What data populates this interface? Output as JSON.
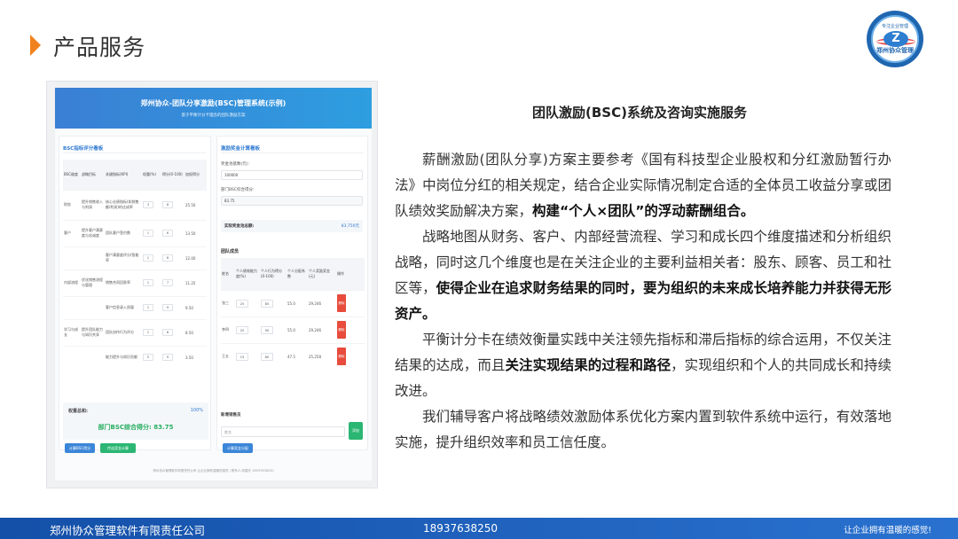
{
  "header": {
    "title": "产品服务"
  },
  "logo": {
    "top_text": "专注企业管理",
    "bottom_text": "郑州协众管理"
  },
  "screenshot": {
    "app_title": "郑州协众-团队分享激励(BSC)管理系统(示例)",
    "app_subtitle": "基于平衡计分卡理念的团队激励方案",
    "left_panel": {
      "title": "BSC指标评分看板",
      "headers": [
        "BSC维度",
        "战略目标",
        "关键指标(KPI)",
        "权重(%)",
        "得分(0-100)",
        "加权得分"
      ],
      "rows": [
        {
          "dim": "财务",
          "goal": "提升销售收入与利润",
          "kpi": "核心业绩指标(如销售额/利润)的达成率",
          "weight": "3",
          "score": "8",
          "weighted": "25.50"
        },
        {
          "dim": "客户",
          "goal": "提升客户满意度与忠诚度",
          "kpi": "团队客户签约数",
          "weight": "1",
          "score": "6",
          "weighted": "13.50"
        },
        {
          "dim": "",
          "goal": "",
          "kpi": "客户满意度评分(智能率",
          "weight": "1",
          "score": "8",
          "weighted": "12.00"
        },
        {
          "dim": "内部流程",
          "goal": "优化销售流程与管理",
          "kpi": "销售合同回款率",
          "weight": "1",
          "score": "7",
          "weighted": "11.25"
        },
        {
          "dim": "",
          "goal": "",
          "kpi": "客户信息录入质量",
          "weight": "1",
          "score": "9",
          "weighted": "9.50"
        },
        {
          "dim": "学习与成长",
          "goal": "提升团队能力与知识共享",
          "kpi": "团队协作行为评分",
          "weight": "1",
          "score": "8",
          "weighted": "8.50"
        },
        {
          "dim": "",
          "goal": "",
          "kpi": "能力提升与知识贡献",
          "weight": "5",
          "score": "9",
          "weighted": "3.50"
        }
      ],
      "total_label": "权重总和:",
      "total_pct": "100%",
      "score_text": "部门BSC综合得分: 83.75",
      "btn_calc": "计算BSC得分",
      "btn_bonus": "传送奖金计算"
    },
    "right_panel": {
      "title": "激励奖金计算看板",
      "pool_label": "奖金池基数(元):",
      "pool_value": "100000",
      "dept_label": "部门BSC综合得分:",
      "dept_value": "83.75",
      "actual_label": "实际奖金池总额:",
      "actual_value": "83,750元",
      "members_title": "团队成员",
      "member_headers": [
        "姓名",
        "个人绩效能力度(%)",
        "个人行为得分(0-100)",
        "个人分配系数",
        "个人奖励奖金(元)",
        "操作"
      ],
      "members": [
        {
          "name": "张三",
          "perf": "25",
          "behave": "85",
          "coef": "55.0",
          "bonus": "29,246",
          "op": "删除"
        },
        {
          "name": "李四",
          "perf": "20",
          "behave": "90",
          "coef": "55.0",
          "bonus": "29,246",
          "op": "删除"
        },
        {
          "name": "王五",
          "perf": "15",
          "behave": "80",
          "coef": "47.5",
          "bonus": "25,258",
          "op": "删除"
        }
      ],
      "new_member_label": "新增销售员",
      "new_member_placeholder": "姓名",
      "add_btn": "添加",
      "calc_btn": "计算奖金分配"
    },
    "footer_text": "郑州协众管理软件有限责任公司 让企业拥有温暖的感觉 | 联系人:何建先 18937638250"
  },
  "article": {
    "title": "团队激励(BSC)系统及咨询实施服务",
    "p1_a": "薪酬激励(团队分享)方案主要参考《国有科技型企业股权和分红激励暂行办法》中岗位分红的相关规定，结合企业实际情况制定合适的全体员工收益分享或团队绩效奖励解决方案，",
    "p1_b": "构建“个人×团队”的浮动薪酬组合。",
    "p2_a": "战略地图从财务、客户、内部经营流程、学习和成长四个维度描述和分析组织战略，同时这几个维度也是在关注企业的主要利益相关者：股东、顾客、员工和社区等，",
    "p2_b": "使得企业在追求财务结果的同时，要为组织的未来成长培养能力并获得无形资产。",
    "p3_a": "平衡计分卡在绩效衡量实践中关注领先指标和滞后指标的综合运用，不仅关注结果的达成，而且",
    "p3_b": "关注实现结果的过程和路径",
    "p3_c": "，实现组织和个人的共同成长和持续改进。",
    "p4": "我们辅导客户将战略绩效激励体系优化方案内置到软件系统中运行，有效落地实施，提升组织效率和员工信任度。"
  },
  "footer": {
    "company": "郑州协众管理软件有限责任公司",
    "phone": "18937638250",
    "slogan": "让企业拥有温暖的感觉!"
  },
  "colors": {
    "accent": "#f0821e",
    "footer": "#1a5cb8",
    "brand_blue": "#2f7ad1"
  }
}
